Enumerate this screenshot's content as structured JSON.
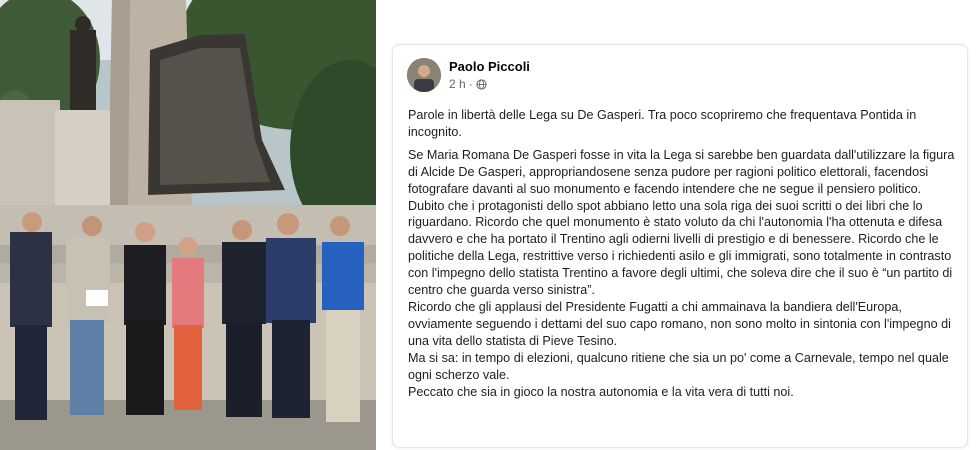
{
  "post": {
    "author_name": "Paolo Piccoli",
    "time_ago": "2 h",
    "visibility_icon": "globe-icon",
    "paragraphs": [
      "Parole in libertà delle Lega su De Gasperi. Tra poco scopriremo che frequentava Pontida in incognito.",
      "Se Maria Romana De Gasperi fosse in vita la Lega si sarebbe ben guardata dall'utilizzare la figura di Alcide De Gasperi, appropriandosene senza pudore per ragioni politico elettorali, facendosi fotografare davanti al suo monumento e facendo intendere che ne segue il pensiero politico. Dubito che i protagonisti dello spot abbiano letto una sola riga dei suoi scritti o dei libri che lo riguardano. Ricordo che quel monumento è stato voluto da chi l'autonomia l'ha ottenuta e difesa davvero e che ha portato il Trentino agli odierni livelli di prestigio e di benessere. Ricordo che le politiche della Lega, restrittive verso i richiedenti asilo e gli immigrati, sono totalmente in contrasto con l'impegno dello statista Trentino a favore degli ultimi, che soleva dire che il suo è “un partito di centro che guarda verso sinistra”.",
      "Ricordo che gli applausi del Presidente Fugatti a chi ammainava la bandiera dell'Europa, ovviamente seguendo i dettami del suo capo romano, non sono molto in sintonia con l'impegno di una vita dello statista di Pieve Tesino.",
      "Ma si sa: in tempo di elezioni, qualcuno ritiene che sia un po' come a Carnevale, tempo nel quale ogni scherzo vale.",
      "Peccato che sia in gioco la nostra autonomia e la vita vera di tutti noi."
    ]
  },
  "colors": {
    "text": "#1c1e21",
    "secondary_text": "#65676b",
    "card_border": "#e4e6eb"
  }
}
